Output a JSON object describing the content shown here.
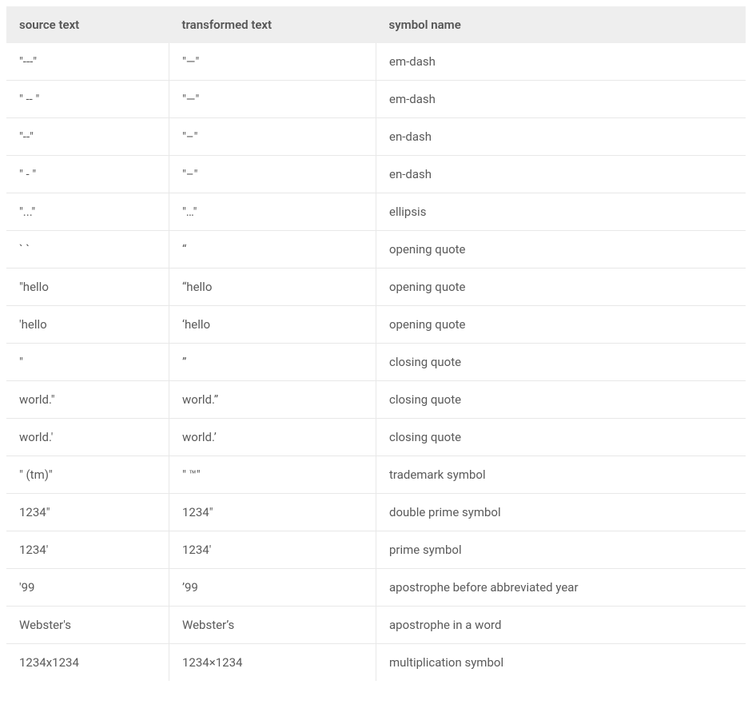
{
  "table": {
    "headers": {
      "source": "source text",
      "transformed": "transformed text",
      "symbol": "symbol name"
    },
    "rows": [
      {
        "source": "\"---\"",
        "transformed": "\"—\"",
        "symbol": "em-dash"
      },
      {
        "source": "\" -- \"",
        "transformed": "\"—\"",
        "symbol": "em-dash"
      },
      {
        "source": "\"--\"",
        "transformed": "\"–\"",
        "symbol": "en-dash"
      },
      {
        "source": "\" - \"",
        "transformed": "\"–\"",
        "symbol": "en-dash"
      },
      {
        "source": "\"...\"",
        "transformed": "\"…\"",
        "symbol": "ellipsis"
      },
      {
        "source": "` `",
        "transformed": "“",
        "symbol": "opening quote"
      },
      {
        "source": "\"hello",
        "transformed": "“hello",
        "symbol": "opening quote"
      },
      {
        "source": "'hello",
        "transformed": "‘hello",
        "symbol": "opening quote"
      },
      {
        "source": "\"",
        "transformed": "”",
        "symbol": "closing quote"
      },
      {
        "source": "world.\"",
        "transformed": "world.”",
        "symbol": "closing quote"
      },
      {
        "source": "world.'",
        "transformed": "world.’",
        "symbol": "closing quote"
      },
      {
        "source": "\" (tm)\"",
        "transformed": "\" ™\"",
        "symbol": "trademark symbol"
      },
      {
        "source": "1234\"",
        "transformed": "1234″",
        "symbol": "double prime symbol"
      },
      {
        "source": "1234'",
        "transformed": "1234′",
        "symbol": "prime symbol"
      },
      {
        "source": "'99",
        "transformed": "’99",
        "symbol": "apostrophe before abbreviated year"
      },
      {
        "source": "Webster's",
        "transformed": "Webster’s",
        "symbol": "apostrophe in a word"
      },
      {
        "source": "1234x1234",
        "transformed": "1234×1234",
        "symbol": "multiplication symbol"
      }
    ]
  }
}
